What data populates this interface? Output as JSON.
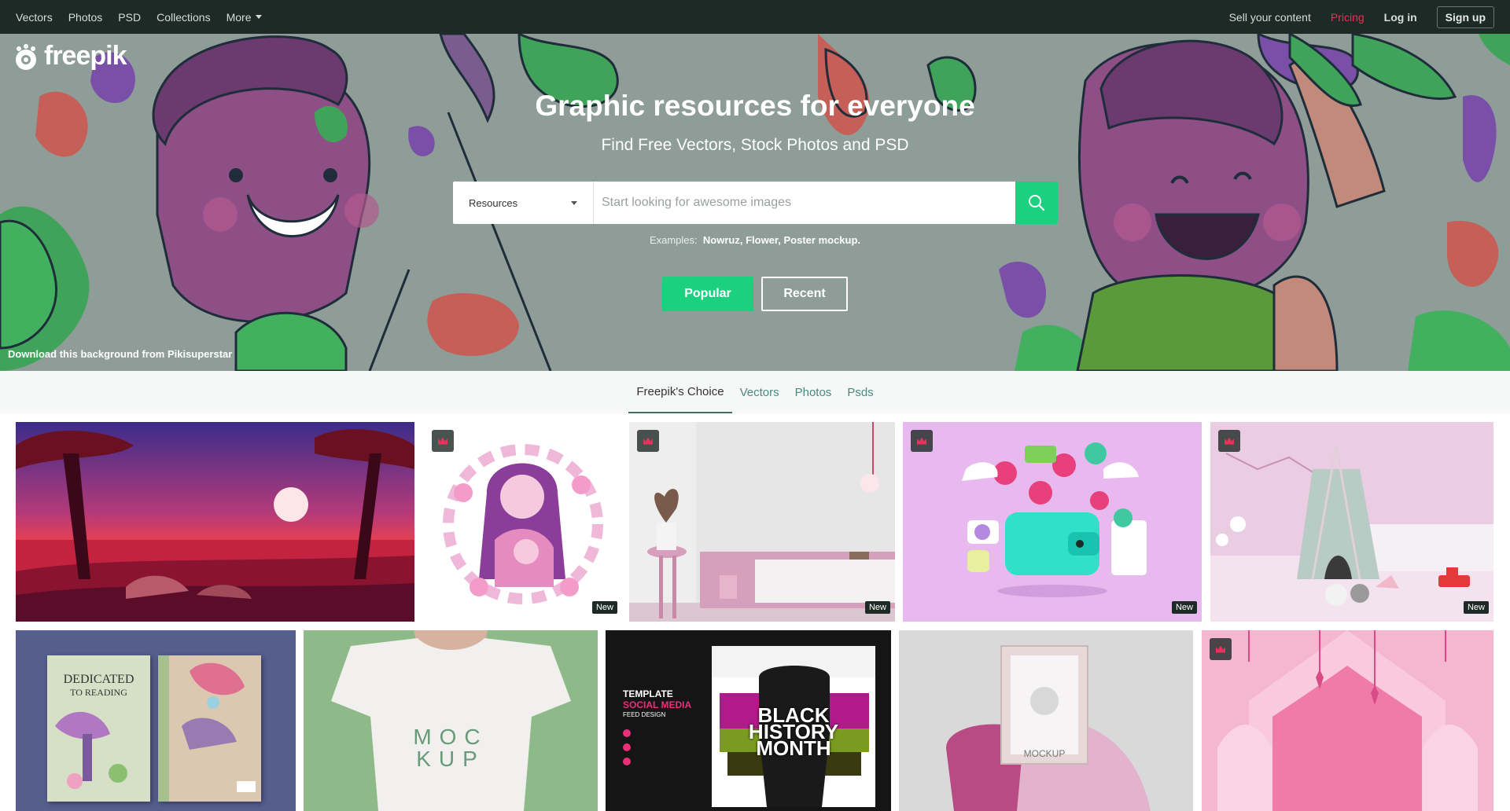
{
  "topnav": {
    "left": [
      "Vectors",
      "Photos",
      "PSD",
      "Collections",
      "More"
    ],
    "sell": "Sell your content",
    "pricing": "Pricing",
    "login": "Log in",
    "signup": "Sign up"
  },
  "logo": {
    "text": "freepik"
  },
  "hero": {
    "title": "Graphic resources for everyone",
    "subtitle": "Find Free Vectors, Stock Photos and PSD",
    "search": {
      "category": "Resources",
      "placeholder": "Start looking for awesome images"
    },
    "examples_label": "Examples:",
    "examples": [
      "Nowruz",
      "Flower",
      "Poster mockup"
    ],
    "tab_popular": "Popular",
    "tab_recent": "Recent",
    "credit": "Download this background from Pikisuperstar"
  },
  "categories": [
    "Freepik's Choice",
    "Vectors",
    "Photos",
    "Psds"
  ],
  "grid": {
    "new_label": "New",
    "tiles": [
      {
        "desc": "landscape",
        "premium": false,
        "new": false
      },
      {
        "desc": "mother",
        "premium": true,
        "new": true
      },
      {
        "desc": "interior",
        "premium": true,
        "new": true
      },
      {
        "desc": "wallet",
        "premium": true,
        "new": true
      },
      {
        "desc": "teepee",
        "premium": true,
        "new": true
      },
      {
        "desc": "book",
        "premium": false,
        "new": false
      },
      {
        "desc": "tshirt",
        "premium": false,
        "new": false
      },
      {
        "desc": "blackhistory",
        "premium": false,
        "new": false
      },
      {
        "desc": "frame",
        "premium": false,
        "new": false
      },
      {
        "desc": "ramadan",
        "premium": true,
        "new": true
      }
    ],
    "book": {
      "title1": "DEDICATED",
      "title2": "TO READING",
      "spine": "DEDICATED TO READING"
    },
    "tshirt": {
      "line1": "MOC",
      "line2": "KUP"
    },
    "bhm": {
      "t1": "TEMPLATE",
      "t2": "SOCIAL MEDIA",
      "t3": "FEED DESIGN",
      "b1": "BLACK",
      "b2": "HISTORY",
      "b3": "MONTH"
    },
    "frame": {
      "label": "MOCKUP"
    }
  },
  "colors": {
    "accent": "#1bd17f",
    "nav_bg": "#1d2a26",
    "pricing": "#e8325c"
  }
}
